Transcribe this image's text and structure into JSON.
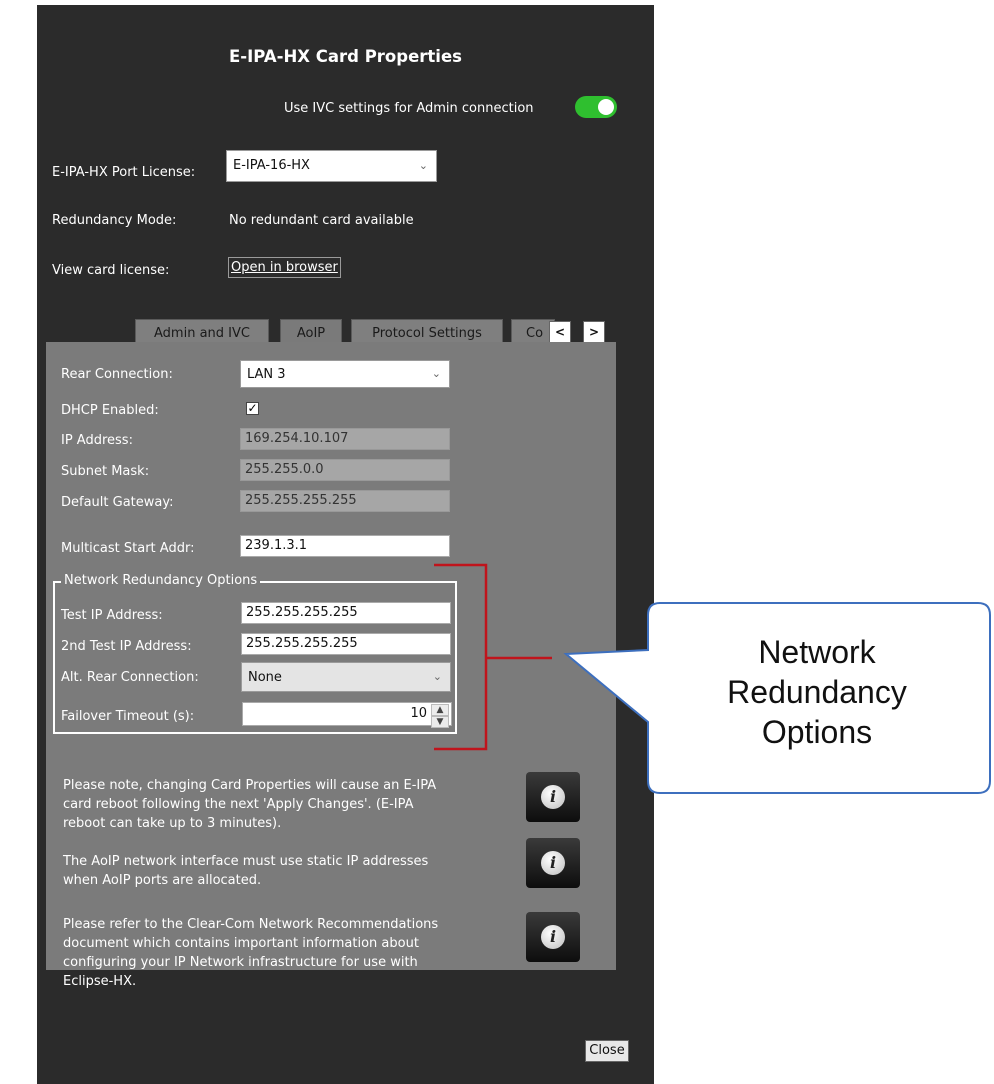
{
  "dialog": {
    "title": "E-IPA-HX Card Properties",
    "ivc_toggle": {
      "label": "Use IVC settings for Admin connection",
      "on": true,
      "color": "#2fbf2f"
    },
    "port_license": {
      "label": "E-IPA-HX Port License:",
      "value": "E-IPA-16-HX"
    },
    "redundancy_mode": {
      "label": "Redundancy Mode:",
      "value": "No redundant card available"
    },
    "card_license": {
      "label": "View card license:",
      "button": "Open in browser"
    },
    "tabs": [
      {
        "label": "Admin and IVC",
        "active": false
      },
      {
        "label": "AoIP",
        "active": true
      },
      {
        "label": "Protocol Settings",
        "active": false
      },
      {
        "label": "Co",
        "active": false
      }
    ],
    "tab_scroll": {
      "left": "<",
      "right": ">"
    },
    "aoip": {
      "rear_connection": {
        "label": "Rear Connection:",
        "value": "LAN 3"
      },
      "dhcp_enabled": {
        "label": "DHCP Enabled:",
        "checked": true
      },
      "ip_address": {
        "label": "IP Address:",
        "value": "169.254.10.107"
      },
      "subnet_mask": {
        "label": "Subnet Mask:",
        "value": "255.255.0.0"
      },
      "default_gateway": {
        "label": "Default Gateway:",
        "value": "255.255.255.255"
      },
      "multicast_start": {
        "label": "Multicast Start Addr:",
        "value": "239.1.3.1"
      },
      "redundancy_group": {
        "title": "Network Redundancy Options",
        "test_ip": {
          "label": "Test IP Address:",
          "value": "255.255.255.255"
        },
        "test_ip2": {
          "label": "2nd Test IP Address:",
          "value": "255.255.255.255"
        },
        "alt_rear": {
          "label": "Alt. Rear Connection:",
          "value": "None"
        },
        "failover": {
          "label": "Failover Timeout (s):",
          "value": "10"
        }
      }
    },
    "notes": [
      {
        "lines": [
          "Please note, changing Card Properties will cause an E-IPA",
          "card reboot following the next 'Apply Changes'. (E-IPA",
          "reboot can take up to 3 minutes)."
        ],
        "icon": "info-icon"
      },
      {
        "lines": [
          "The AoIP network interface must use static IP addresses",
          "when AoIP ports are allocated."
        ],
        "icon": "info-icon"
      },
      {
        "lines": [
          "Please refer to the Clear-Com Network Recommendations",
          "document which contains important information about",
          "configuring your IP Network infrastructure for use with",
          "Eclipse-HX."
        ],
        "icon": "info-icon"
      }
    ],
    "close_button": "Close"
  },
  "callout": {
    "lines": [
      "Network",
      "Redundancy",
      "Options"
    ],
    "bracket_color": "#c0141c"
  }
}
